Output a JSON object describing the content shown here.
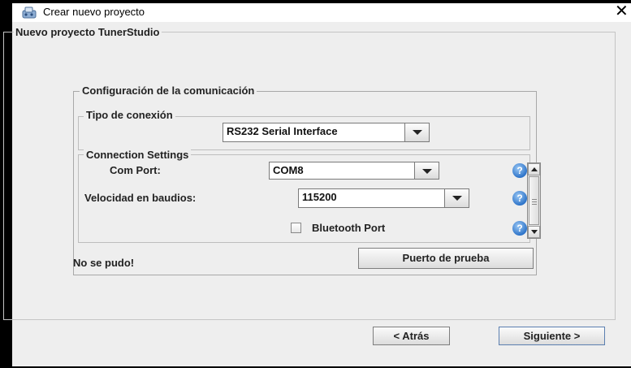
{
  "window": {
    "title": "Crear nuevo proyecto",
    "close_symbol": "✕",
    "icon": "project-app-icon"
  },
  "project_group": {
    "title": "Nuevo proyecto TunerStudio"
  },
  "comm_group": {
    "title": "Configuración de la comunicación",
    "connection_type": {
      "title": "Tipo de conexión",
      "selected": "RS232 Serial Interface"
    },
    "connection_settings": {
      "title": "Connection Settings",
      "com_port_label": "Com Port:",
      "com_port_value": "COM8",
      "baud_label": "Velocidad en baudios:",
      "baud_value": "115200",
      "bluetooth_label": "Bluetooth Port",
      "bluetooth_checked": false,
      "help_symbol": "?"
    },
    "status_message": "No se pudo!",
    "test_port_button": "Puerto de prueba"
  },
  "footer": {
    "back_button": "< Atrás",
    "next_button": "Siguiente >"
  },
  "colors": {
    "window_bg": "#eeeeee",
    "help_icon": "#2e74c9",
    "frame": "#000000"
  }
}
